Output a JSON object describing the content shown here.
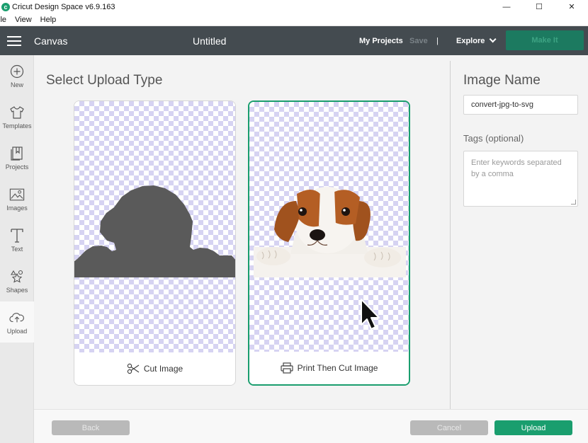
{
  "window": {
    "title": "Cricut Design Space  v6.9.163",
    "controls": {
      "minimize": "—",
      "maximize": "☐",
      "close": "✕"
    }
  },
  "menu": [
    "ile",
    "View",
    "Help"
  ],
  "header": {
    "section": "Canvas",
    "doc_title": "Untitled",
    "my_projects": "My Projects",
    "save": "Save",
    "divider": "|",
    "explore": "Explore",
    "make_it": "Make It"
  },
  "sidebar": {
    "items": [
      {
        "label": "New",
        "icon": "plus-circle-icon"
      },
      {
        "label": "Templates",
        "icon": "shirt-icon"
      },
      {
        "label": "Projects",
        "icon": "projects-icon"
      },
      {
        "label": "Images",
        "icon": "image-icon"
      },
      {
        "label": "Text",
        "icon": "text-icon"
      },
      {
        "label": "Shapes",
        "icon": "shapes-icon"
      },
      {
        "label": "Upload",
        "icon": "cloud-upload-icon",
        "active": true
      }
    ]
  },
  "main": {
    "title": "Select Upload Type",
    "options": [
      {
        "label": "Cut Image",
        "icon": "scissors-icon",
        "selected": false
      },
      {
        "label": "Print Then Cut Image",
        "icon": "printer-icon",
        "selected": true
      }
    ]
  },
  "right_panel": {
    "title": "Image Name",
    "name_value": "convert-jpg-to-svg",
    "tags_label": "Tags (optional)",
    "tags_placeholder": "Enter keywords separated by a comma"
  },
  "footer": {
    "back": "Back",
    "cancel": "Cancel",
    "upload": "Upload"
  },
  "colors": {
    "accent": "#1a9e6e",
    "header_bg": "#444b50",
    "checker": "#d6d3f2"
  }
}
